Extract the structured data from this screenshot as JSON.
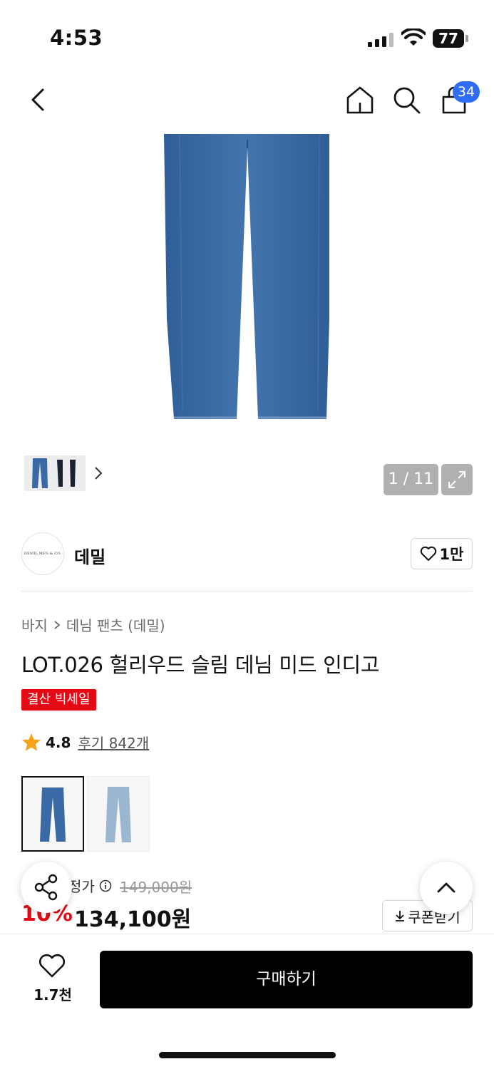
{
  "status_bar": {
    "time": "4:53",
    "battery": "77"
  },
  "header": {
    "cart_count": "34"
  },
  "gallery": {
    "counter": "1 / 11"
  },
  "brand": {
    "logo_text": "DEMIL MFG & CO.",
    "name": "데밀",
    "likes": "1만"
  },
  "breadcrumb": {
    "category": "바지",
    "subcategory": "데님 팬츠 (데밀)"
  },
  "product": {
    "title": "LOT.026 헐리우드 슬림 데님 미드 인디고",
    "badge": "결산 빅세일",
    "rating": "4.8",
    "reviews": "후기 842개",
    "colors": [
      {
        "name": "mid-indigo",
        "hex": "#3a6aa5"
      },
      {
        "name": "light-wash",
        "hex": "#9ab7cf"
      }
    ]
  },
  "price": {
    "label": "정가",
    "original": "149,000원",
    "discount": "10%",
    "current": "134,100원",
    "coupon_label": "쿠폰받기"
  },
  "bottom": {
    "wish_count": "1.7천",
    "buy_label": "구매하기"
  },
  "colors": {
    "accent": "#2f6df6",
    "sale": "#e50914",
    "denim": "#3a6aa5"
  }
}
